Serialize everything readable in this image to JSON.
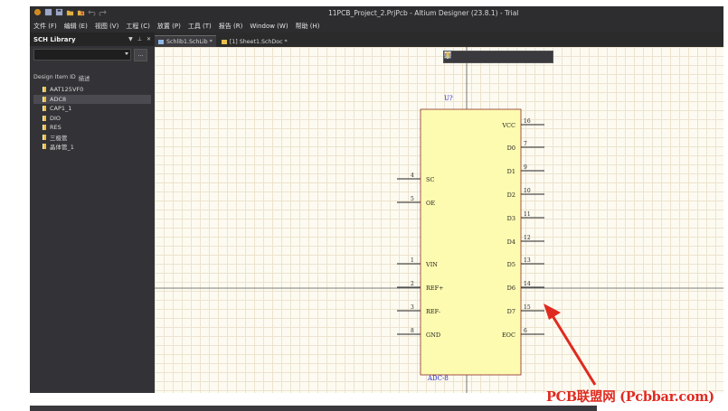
{
  "app": {
    "title": "11PCB_Project_2.PrjPcb - Altium Designer (23.8.1) - Trial"
  },
  "menu": [
    {
      "label": "文件 (F)"
    },
    {
      "label": "编辑 (E)"
    },
    {
      "label": "视图 (V)"
    },
    {
      "label": "工程 (C)"
    },
    {
      "label": "放置 (P)"
    },
    {
      "label": "工具 (T)"
    },
    {
      "label": "报告 (R)"
    },
    {
      "label": "Window (W)"
    },
    {
      "label": "帮助 (H)"
    }
  ],
  "panel": {
    "title": "SCH Library",
    "column_id": "Design Item ID",
    "column_desc": "描述",
    "items": [
      {
        "label": "AAT125VF0",
        "selected": false
      },
      {
        "label": "ADC8",
        "selected": true
      },
      {
        "label": "CAP1_1",
        "selected": false
      },
      {
        "label": "DIO",
        "selected": false
      },
      {
        "label": "RES",
        "selected": false
      },
      {
        "label": "三极管",
        "selected": false
      },
      {
        "label": "晶体管_1",
        "selected": false
      }
    ]
  },
  "tabs": [
    {
      "label": "Schlib1.SchLib *",
      "active": true,
      "icon": "schlib-icon"
    },
    {
      "label": "[1] Sheet1.SchDoc *",
      "active": false,
      "icon": "schdoc-icon"
    }
  ],
  "component": {
    "designator": "U?",
    "comment": "ADC-8",
    "left_pins": [
      {
        "num": "4",
        "name": "SC"
      },
      {
        "num": "5",
        "name": "OE"
      },
      {
        "num": "1",
        "name": "VIN"
      },
      {
        "num": "2",
        "name": "REF+"
      },
      {
        "num": "3",
        "name": "REF-"
      },
      {
        "num": "8",
        "name": "GND"
      }
    ],
    "right_pins": [
      {
        "num": "16",
        "name": "VCC"
      },
      {
        "num": "7",
        "name": "D0"
      },
      {
        "num": "9",
        "name": "D1"
      },
      {
        "num": "10",
        "name": "D2"
      },
      {
        "num": "11",
        "name": "D3"
      },
      {
        "num": "12",
        "name": "D4"
      },
      {
        "num": "13",
        "name": "D5"
      },
      {
        "num": "14",
        "name": "D6"
      },
      {
        "num": "15",
        "name": "D7"
      },
      {
        "num": "6",
        "name": "EOC"
      }
    ]
  },
  "colors": {
    "body_fill": "#fdfbb0",
    "body_stroke": "#8a2a2a",
    "label_blue": "#2828c8",
    "annotation_red": "#e02a1f"
  },
  "watermark": "PCB联盟网 (Pcbbar.com)"
}
